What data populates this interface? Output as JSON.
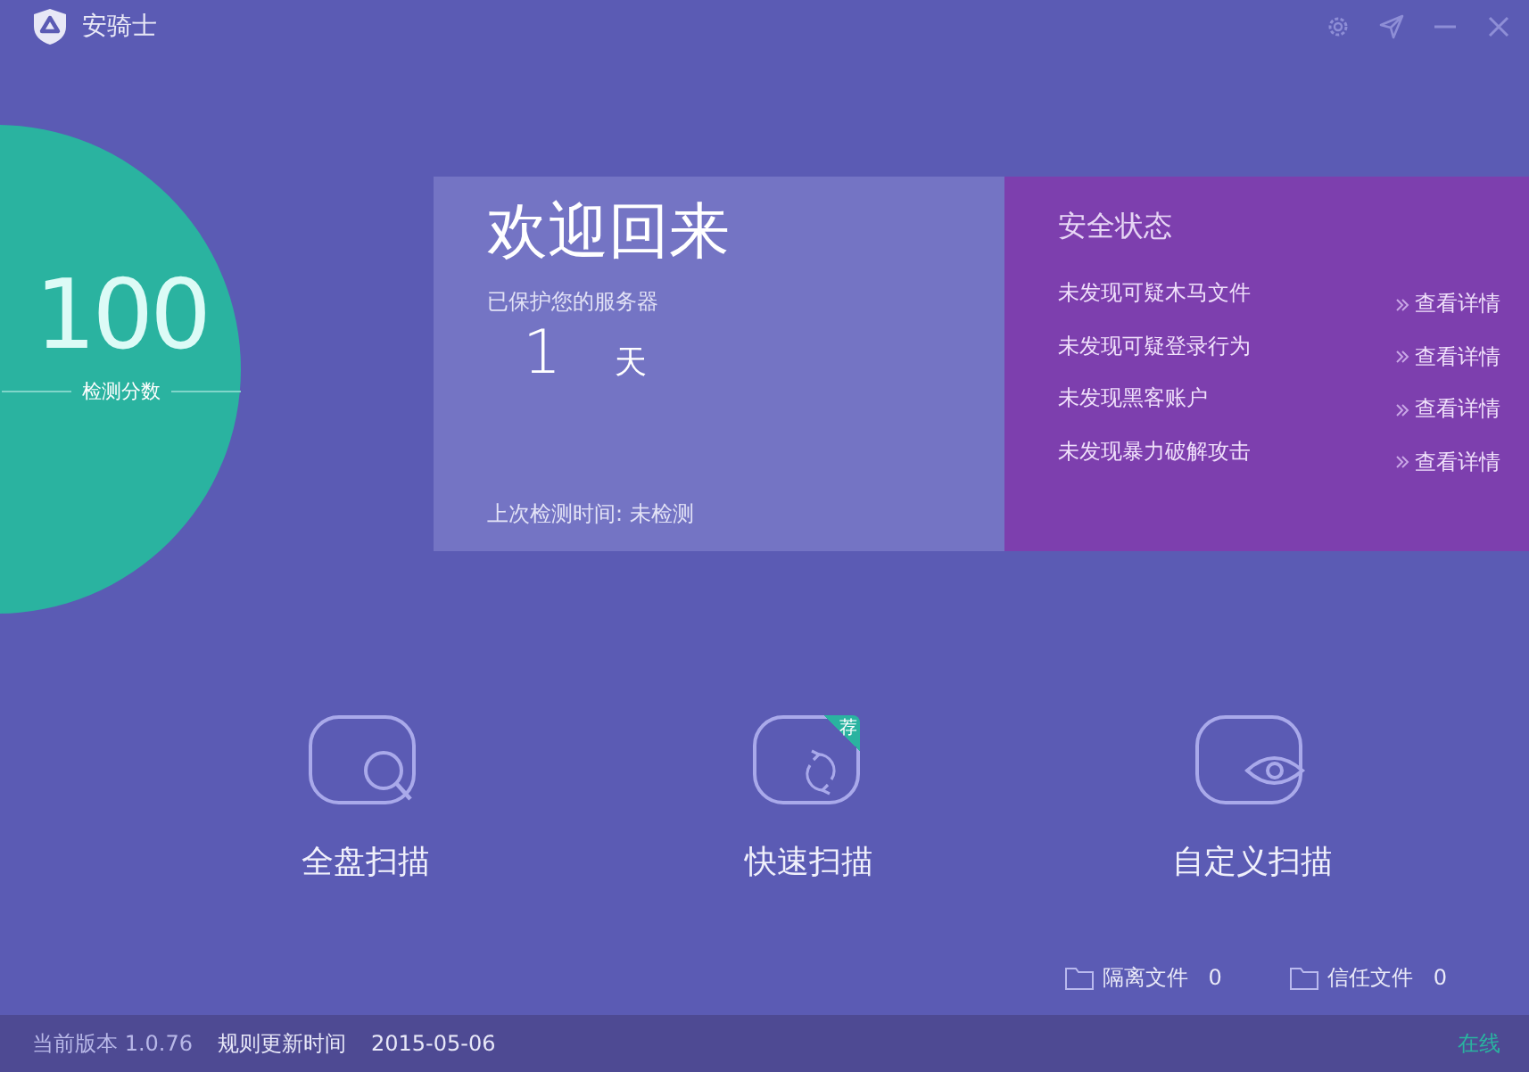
{
  "window": {
    "title": "安骑士"
  },
  "score": {
    "value": "100",
    "label": "检测分数"
  },
  "welcome": {
    "title": "欢迎回来",
    "protected_label": "已保护您的服务器",
    "days": "1",
    "days_unit": "天",
    "last_check": "上次检测时间: 未检测"
  },
  "security": {
    "title": "安全状态",
    "items": [
      {
        "text": "未发现可疑木马文件",
        "link": "查看详情"
      },
      {
        "text": "未发现可疑登录行为",
        "link": "查看详情"
      },
      {
        "text": "未发现黑客账户",
        "link": "查看详情"
      },
      {
        "text": "未发现暴力破解攻击",
        "link": "查看详情"
      }
    ]
  },
  "scans": [
    {
      "kind": "search",
      "label": "全盘扫描"
    },
    {
      "kind": "refresh",
      "label": "快速扫描",
      "badge": "荐"
    },
    {
      "kind": "eye",
      "label": "自定义扫描"
    }
  ],
  "files": [
    {
      "label": "隔离文件",
      "count": "0"
    },
    {
      "label": "信任文件",
      "count": "0"
    }
  ],
  "status_bar": {
    "version_label": "当前版本",
    "version": "1.0.76",
    "rules_label": "规则更新时间",
    "rules_date": "2015-05-06",
    "connection": "在线"
  }
}
